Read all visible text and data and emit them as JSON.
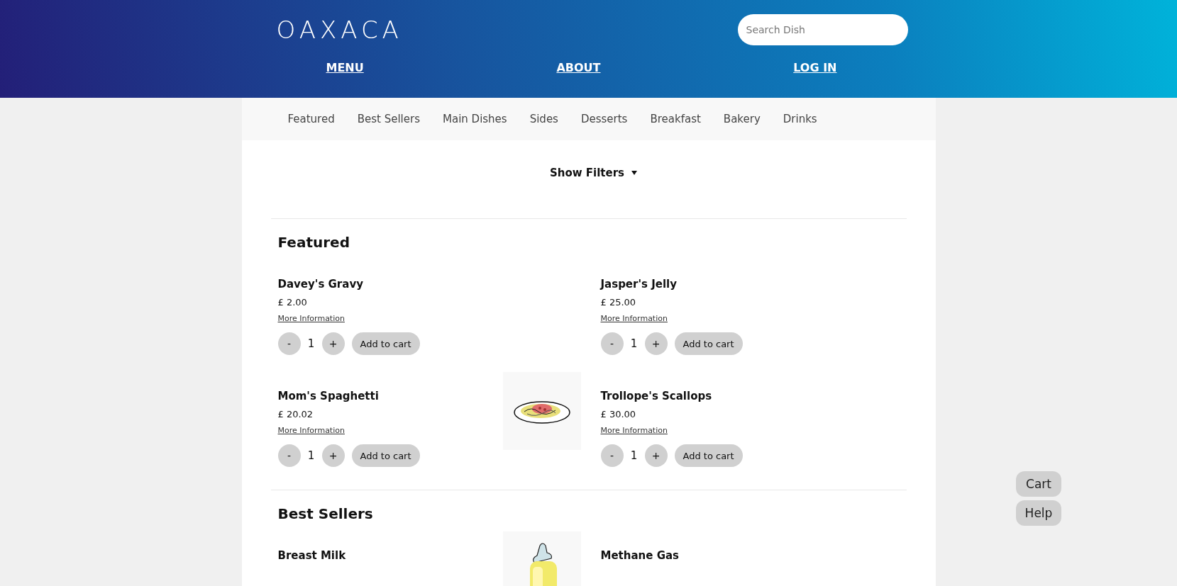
{
  "header": {
    "logo": "OAXACA",
    "search": {
      "placeholder": "Search Dish"
    },
    "nav": [
      "MENU",
      "ABOUT",
      "LOG IN"
    ]
  },
  "categories": [
    "Featured",
    "Best Sellers",
    "Main Dishes",
    "Sides",
    "Desserts",
    "Breakfast",
    "Bakery",
    "Drinks"
  ],
  "filters": {
    "label": "Show Filters",
    "expanded": false
  },
  "sections": [
    {
      "title": "Featured",
      "items": [
        {
          "name": "Davey's Gravy",
          "price": "£ 2.00",
          "link": "More Information",
          "minus": "-",
          "quantity": "1",
          "plus": "+",
          "add": "Add to cart"
        },
        {
          "name": "Jasper's Jelly",
          "price": "£ 25.00",
          "link": "More Information",
          "minus": "-",
          "quantity": "1",
          "plus": "+",
          "add": "Add to cart"
        },
        {
          "name": "Mom's Spaghetti",
          "price": "£ 20.02",
          "link": "More Information",
          "minus": "-",
          "quantity": "1",
          "plus": "+",
          "add": "Add to cart"
        },
        {
          "name": "Trollope's Scallops",
          "price": "£ 30.00",
          "link": "More Information",
          "minus": "-",
          "quantity": "1",
          "plus": "+",
          "add": "Add to cart"
        }
      ]
    },
    {
      "title": "Best Sellers",
      "items": [
        {
          "name": "Breast Milk"
        },
        {
          "name": "Methane Gas"
        }
      ]
    }
  ],
  "floating": [
    "Cart",
    "Help"
  ]
}
